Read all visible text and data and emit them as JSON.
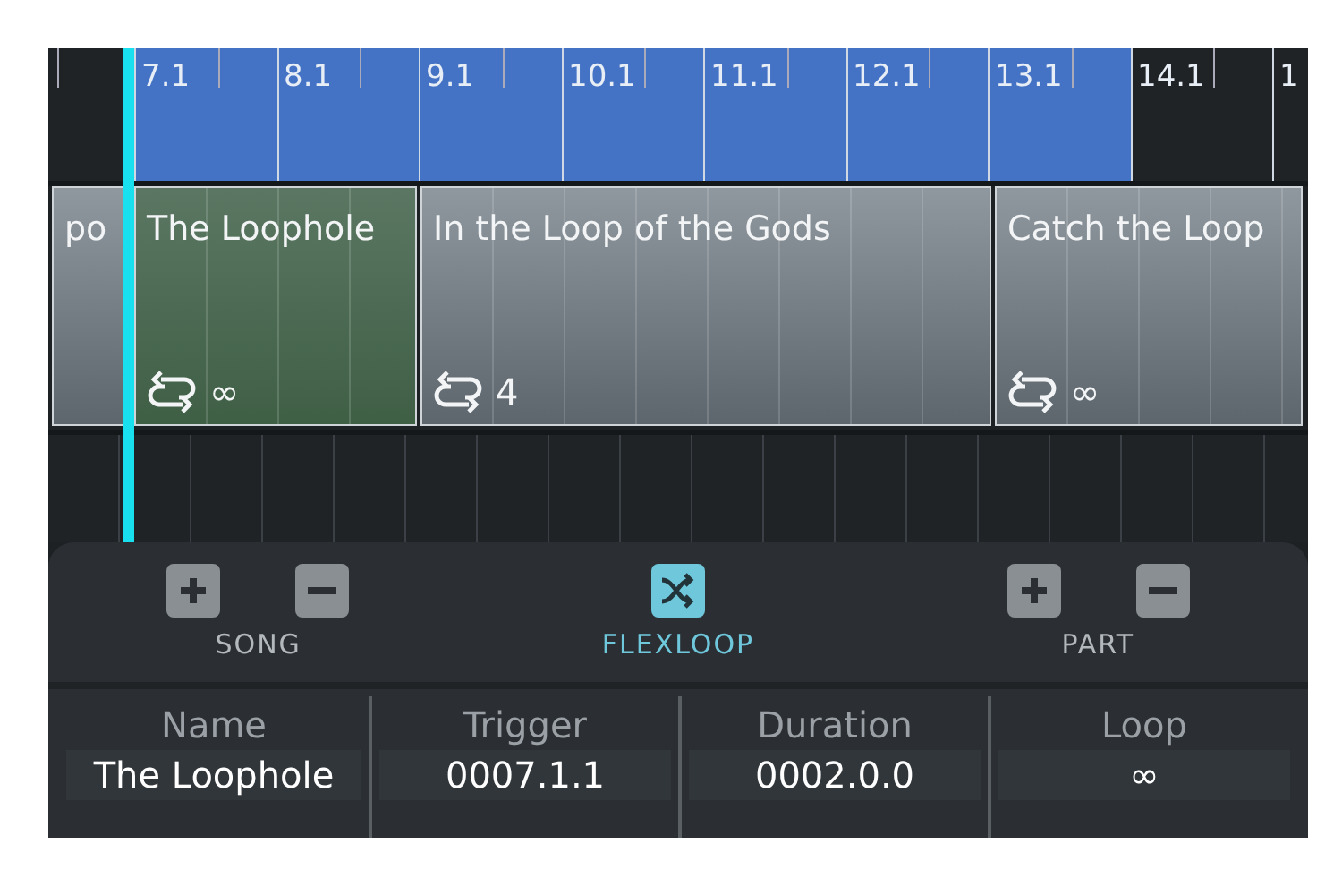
{
  "ruler": [
    {
      "label": "7.1",
      "in_loop": true
    },
    {
      "label": "8.1",
      "in_loop": true
    },
    {
      "label": "9.1",
      "in_loop": true
    },
    {
      "label": "10.1",
      "in_loop": true
    },
    {
      "label": "11.1",
      "in_loop": true
    },
    {
      "label": "12.1",
      "in_loop": true
    },
    {
      "label": "13.1",
      "in_loop": true
    },
    {
      "label": "14.1",
      "in_loop": false
    },
    {
      "label": "1",
      "in_loop": false
    }
  ],
  "parts": [
    {
      "name": "po",
      "selected": false
    },
    {
      "name": "The Loophole",
      "selected": true,
      "loop": "∞"
    },
    {
      "name": "In the Loop of the Gods",
      "selected": false,
      "loop": "4"
    },
    {
      "name": "Catch the Loop",
      "selected": false,
      "loop": "∞"
    }
  ],
  "toolbar": [
    {
      "label": "SONG",
      "kind": "pair",
      "active": false
    },
    {
      "label": "FLEXLOOP",
      "kind": "toggle",
      "active": true
    },
    {
      "label": "PART",
      "kind": "pair",
      "active": false
    }
  ],
  "fields": [
    {
      "label": "Name",
      "value": "The Loophole"
    },
    {
      "label": "Trigger",
      "value": "0007.1.1"
    },
    {
      "label": "Duration",
      "value": "0002.0.0"
    },
    {
      "label": "Loop",
      "value": "∞"
    }
  ]
}
